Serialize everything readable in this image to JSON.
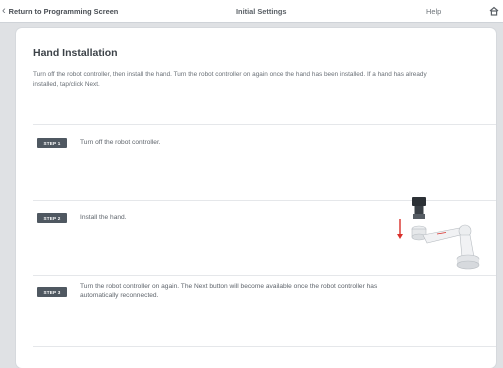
{
  "header": {
    "back_label": "Return to Programming Screen",
    "title": "Initial Settings",
    "help_label": "Help"
  },
  "main": {
    "heading": "Hand Installation",
    "intro": "Turn off the robot controller, then install the hand. Turn the robot controller on again once the hand has been installed. If a hand has already installed, tap/click Next.",
    "steps": [
      {
        "badge": "STEP 1",
        "text": "Turn off the robot controller."
      },
      {
        "badge": "STEP 2",
        "text": "Install the hand."
      },
      {
        "badge": "STEP 3",
        "text": "Turn the robot controller on again. The Next button will become available once the robot controller has automatically reconnected."
      }
    ]
  },
  "icons": {
    "back": "chevron-left-icon",
    "home": "home-icon",
    "illustration": "robot-arm-hand-illustration"
  },
  "colors": {
    "step_badge": "#4f5861",
    "arrow": "#d9302b",
    "background": "#dfe1e4"
  }
}
